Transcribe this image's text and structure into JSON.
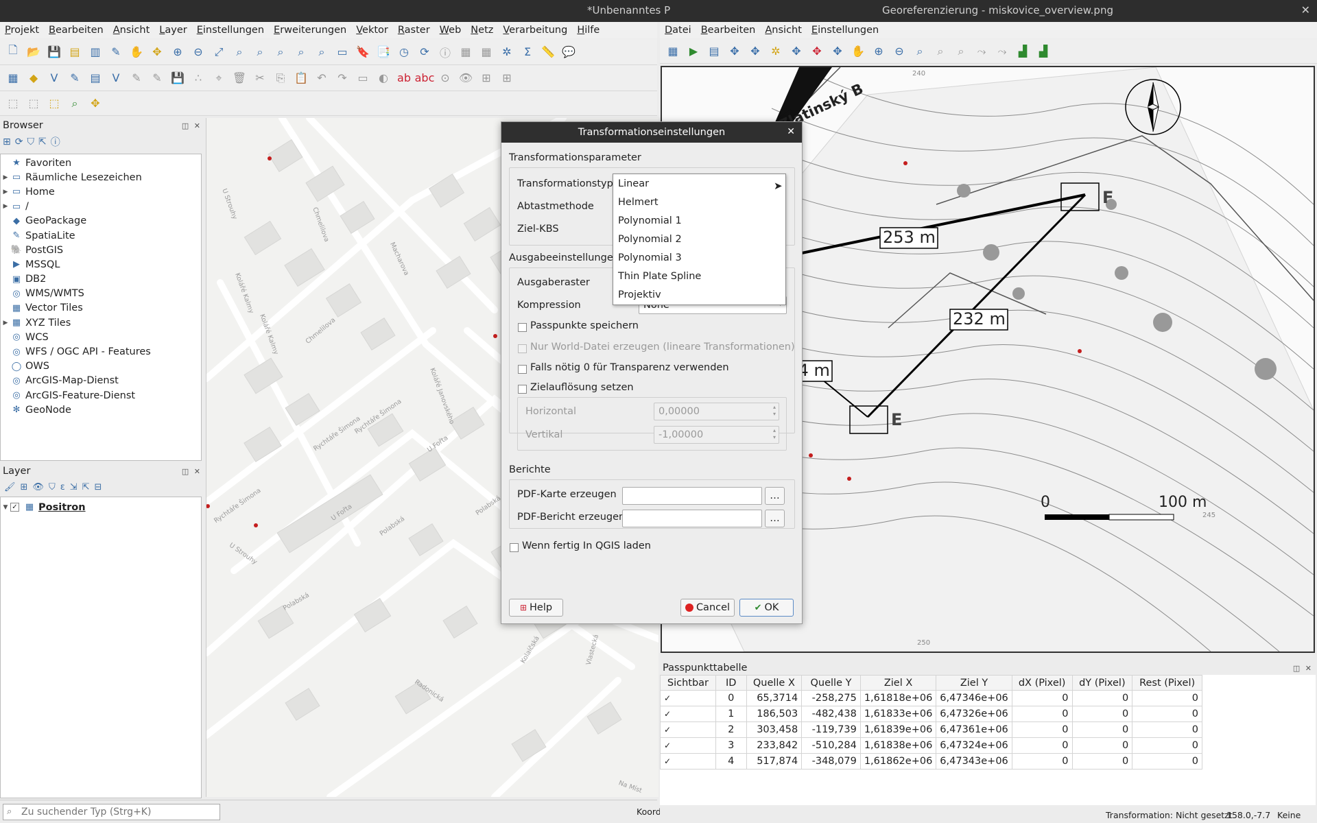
{
  "window": {
    "qgis_title": "*Unbenanntes P",
    "georef_title": "Georeferenzierung - miskovice_overview.png",
    "close": "✕"
  },
  "qgis_menu": [
    "Projekt",
    "Bearbeiten",
    "Ansicht",
    "Layer",
    "Einstellungen",
    "Erweiterungen",
    "Vektor",
    "Raster",
    "Web",
    "Netz",
    "Verarbeitung",
    "Hilfe"
  ],
  "georef_menu": [
    "Datei",
    "Bearbeiten",
    "Ansicht",
    "Einstellungen"
  ],
  "browser": {
    "title": "Browser",
    "items": [
      {
        "label": "Favoriten",
        "icon": "star-icon",
        "glyph": "★",
        "expand": ""
      },
      {
        "label": "Räumliche Lesezeichen",
        "icon": "bookmark-icon",
        "glyph": "▭",
        "expand": "▶"
      },
      {
        "label": "Home",
        "icon": "folder-icon",
        "glyph": "▭",
        "expand": "▶"
      },
      {
        "label": "/",
        "icon": "folder-icon",
        "glyph": "▭",
        "expand": "▶"
      },
      {
        "label": "GeoPackage",
        "icon": "geopackage-icon",
        "glyph": "◆",
        "expand": ""
      },
      {
        "label": "SpatiaLite",
        "icon": "spatialite-icon",
        "glyph": "✎",
        "expand": ""
      },
      {
        "label": "PostGIS",
        "icon": "postgis-icon",
        "glyph": "🐘",
        "expand": ""
      },
      {
        "label": "MSSQL",
        "icon": "mssql-icon",
        "glyph": "▶",
        "expand": ""
      },
      {
        "label": "DB2",
        "icon": "db2-icon",
        "glyph": "▣",
        "expand": ""
      },
      {
        "label": "WMS/WMTS",
        "icon": "wms-icon",
        "glyph": "◎",
        "expand": ""
      },
      {
        "label": "Vector Tiles",
        "icon": "vector-tiles-icon",
        "glyph": "▦",
        "expand": ""
      },
      {
        "label": "XYZ Tiles",
        "icon": "xyz-tiles-icon",
        "glyph": "▦",
        "expand": "▶"
      },
      {
        "label": "WCS",
        "icon": "wcs-icon",
        "glyph": "◎",
        "expand": ""
      },
      {
        "label": "WFS / OGC API - Features",
        "icon": "wfs-icon",
        "glyph": "◎",
        "expand": ""
      },
      {
        "label": "OWS",
        "icon": "ows-icon",
        "glyph": "◯",
        "expand": ""
      },
      {
        "label": "ArcGIS-Map-Dienst",
        "icon": "arcgis-map-icon",
        "glyph": "◎",
        "expand": ""
      },
      {
        "label": "ArcGIS-Feature-Dienst",
        "icon": "arcgis-feature-icon",
        "glyph": "◎",
        "expand": ""
      },
      {
        "label": "GeoNode",
        "icon": "geonode-icon",
        "glyph": "✻",
        "expand": ""
      }
    ]
  },
  "layers": {
    "title": "Layer",
    "items": [
      {
        "label": "Positron",
        "checked": true
      }
    ]
  },
  "search": {
    "placeholder": "Zu suchender Typ (Strg+K)",
    "coord_label": "Koord"
  },
  "map_streets": [
    "U Strouhy",
    "Chmelilova",
    "Kolářé Kalmy",
    "Macharova",
    "Kolářé Kalmy",
    "Chmelilova",
    "Rychtáře Šimona",
    "Rychtáře Šimona",
    "Rychtáře Šimona",
    "U Fořta",
    "U Fořta",
    "U Strouhy",
    "Polabská",
    "Polabská",
    "Kolářé Janovského",
    "Polabská",
    "Radonická",
    "Kolaíčská",
    "Vlastecká",
    "Na Míst"
  ],
  "georef_map": {
    "street": "Zlatinský B",
    "labels": {
      "d1": "253 m",
      "d2": "232 m",
      "d3": "134 m",
      "f": "F",
      "e": "E"
    },
    "scale_zero": "0",
    "scale_end": "100 m",
    "contours": [
      "240",
      "245",
      "250"
    ]
  },
  "dialog": {
    "title": "Transformationseinstellungen",
    "group_params": "Transformationsparameter",
    "transform_type_label": "Transformationstyp",
    "resampling_label": "Abtastmethode",
    "target_crs_label": "Ziel-KBS",
    "group_output": "Ausgabeeinstellungen",
    "output_raster_label": "Ausgaberaster",
    "compression_label": "Kompression",
    "compression_value": "None",
    "save_gcps": "Passpunkte speichern",
    "world_file_only": "Nur World-Datei erzeugen (lineare Transformationen)",
    "use_zero_transparency": "Falls nötig 0 für Transparenz verwenden",
    "set_target_resolution": "Zielauflösung setzen",
    "horizontal_label": "Horizontal",
    "horizontal_value": "0,00000",
    "vertical_label": "Vertikal",
    "vertical_value": "-1,00000",
    "group_reports": "Berichte",
    "pdf_map_label": "PDF-Karte erzeugen",
    "pdf_report_label": "PDF-Bericht erzeugen",
    "browse": "…",
    "load_in_qgis": "Wenn fertig In QGIS laden",
    "help": "Help",
    "cancel": "Cancel",
    "ok": "OK",
    "dropdown_options": [
      "Linear",
      "Helmert",
      "Polynomial 1",
      "Polynomial 2",
      "Polynomial 3",
      "Thin Plate Spline",
      "Projektiv"
    ]
  },
  "gcp_table": {
    "title": "Passpunkttabelle",
    "headers": [
      "Sichtbar",
      "ID",
      "Quelle X",
      "Quelle Y",
      "Ziel X",
      "Ziel Y",
      "dX (Pixel)",
      "dY (Pixel)",
      "Rest (Pixel)"
    ],
    "rows": [
      [
        "✓",
        "0",
        "65,3714",
        "-258,275",
        "1,61818e+06",
        "6,47346e+06",
        "0",
        "0",
        "0"
      ],
      [
        "✓",
        "1",
        "186,503",
        "-482,438",
        "1,61833e+06",
        "6,47326e+06",
        "0",
        "0",
        "0"
      ],
      [
        "✓",
        "2",
        "303,458",
        "-119,739",
        "1,61839e+06",
        "6,47361e+06",
        "0",
        "0",
        "0"
      ],
      [
        "✓",
        "3",
        "233,842",
        "-510,284",
        "1,61838e+06",
        "6,47324e+06",
        "0",
        "0",
        "0"
      ],
      [
        "✓",
        "4",
        "517,874",
        "-348,079",
        "1,61862e+06",
        "6,47343e+06",
        "0",
        "0",
        "0"
      ]
    ]
  },
  "status": {
    "transformation": "Transformation: Nicht gesetzt",
    "coords": "158.0,-7.7",
    "none": "Keine"
  },
  "colors": {
    "accent": "#3b6ea5",
    "titlebar": "#2d2d2d"
  }
}
